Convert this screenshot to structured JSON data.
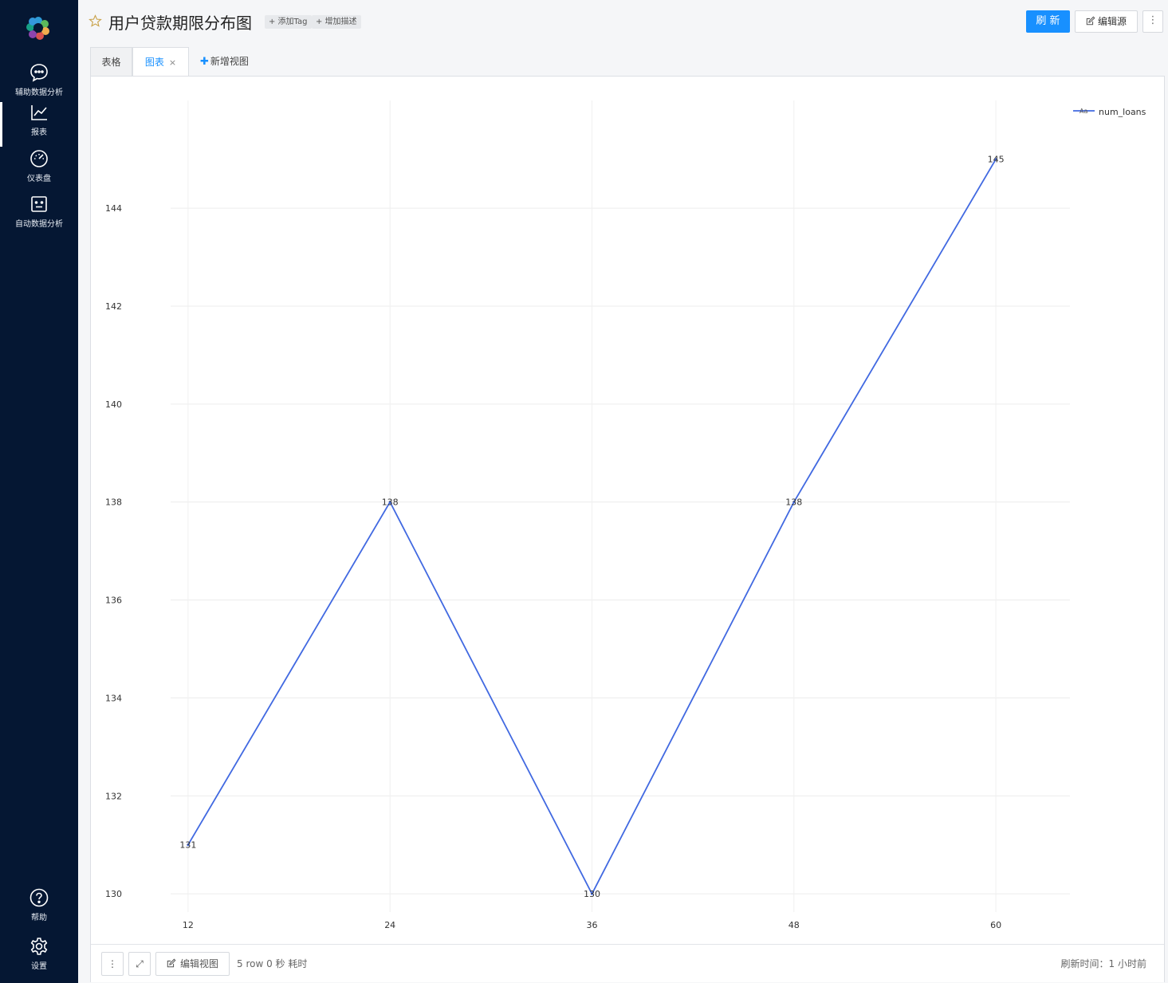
{
  "sidebar": {
    "items": [
      {
        "label": "辅助数据分析",
        "icon": "chat-icon"
      },
      {
        "label": "报表",
        "icon": "line-chart-icon"
      },
      {
        "label": "仪表盘",
        "icon": "gauge-icon"
      },
      {
        "label": "自动数据分析",
        "icon": "robot-icon"
      }
    ],
    "bottom": [
      {
        "label": "帮助",
        "icon": "help-icon"
      },
      {
        "label": "设置",
        "icon": "settings-icon"
      }
    ]
  },
  "header": {
    "title": "用户贷款期限分布图",
    "add_tag": "+ 添加Tag",
    "add_desc": "+ 增加描述",
    "refresh": "刷 新",
    "edit_source": "编辑源",
    "more": "⋮"
  },
  "tabs": {
    "table": "表格",
    "chart": "图表",
    "close": "×",
    "new_view": "新增视图"
  },
  "chart_data": {
    "type": "line",
    "x": [
      12,
      24,
      36,
      48,
      60
    ],
    "series": [
      {
        "name": "num_loans",
        "values": [
          131,
          138,
          130,
          138,
          145
        ],
        "color": "#4169e1"
      }
    ],
    "x_ticks": [
      "12",
      "24",
      "36",
      "48",
      "60"
    ],
    "y_ticks": [
      "130",
      "132",
      "134",
      "136",
      "138",
      "140",
      "142",
      "144"
    ],
    "ylim": [
      129.4,
      146.2
    ],
    "xlim": [
      8.5,
      64.4
    ],
    "grid": true,
    "legend_position": "top-right",
    "legend_marker": "Aa",
    "data_labels": true
  },
  "footer": {
    "more": "⋮",
    "expand": "⤢",
    "edit_view": "编辑视图",
    "info": "5 row 0 秒 耗时",
    "refresh_time": "刷新时间：1 小时前"
  }
}
